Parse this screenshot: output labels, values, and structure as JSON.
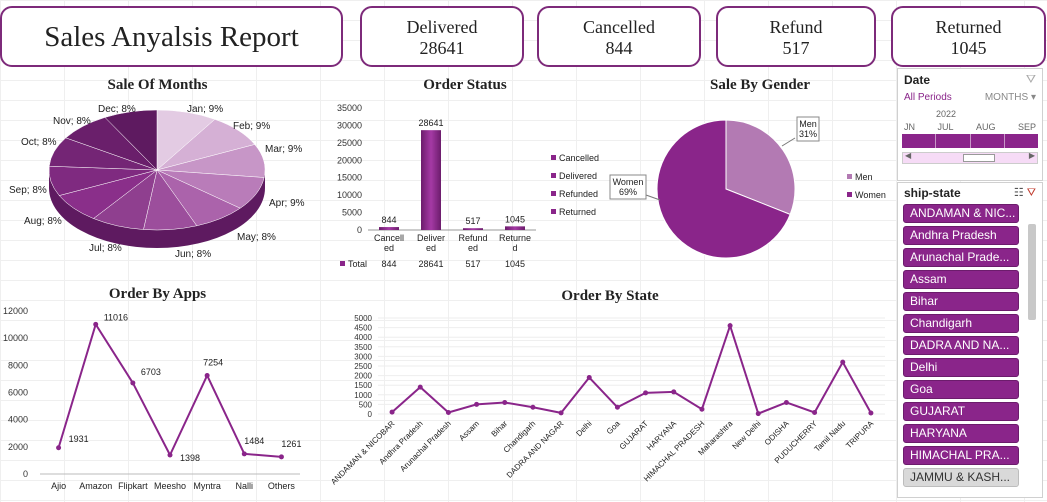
{
  "report": {
    "title": "Sales Anyalsis Report"
  },
  "kpis": [
    {
      "label": "Delivered",
      "value": "28641"
    },
    {
      "label": "Cancelled",
      "value": "844"
    },
    {
      "label": "Refund",
      "value": "517"
    },
    {
      "label": "Returned",
      "value": "1045"
    }
  ],
  "colors": {
    "accent": "#7d2a7a",
    "purple": "#8a258a",
    "light_purple": "#c796c7"
  },
  "chart_data": [
    {
      "type": "pie",
      "title": "Sale Of Months",
      "categories": [
        "Jan",
        "Feb",
        "Mar",
        "Apr",
        "May",
        "Jun",
        "Jul",
        "Aug",
        "Sep",
        "Oct",
        "Nov",
        "Dec"
      ],
      "values": [
        9,
        9,
        9,
        9,
        8,
        8,
        8,
        8,
        8,
        8,
        8,
        8
      ],
      "labels": [
        "Jan; 9%",
        "Feb; 9%",
        "Mar; 9%",
        "Apr; 9%",
        "May; 8%",
        "Jun; 8%",
        "Jul; 8%",
        "Aug; 8%",
        "Sep; 8%",
        "Oct; 8%",
        "Nov; 8%",
        "Dec; 8%"
      ]
    },
    {
      "type": "bar",
      "title": "Order Status",
      "categories": [
        "Cancelled",
        "Delivered",
        "Refunded",
        "Returned"
      ],
      "axis_labels": [
        "Cancell ed",
        "Deliver ed",
        "Refund ed",
        "Returne d"
      ],
      "series": [
        {
          "name": "Total",
          "values": [
            844,
            28641,
            517,
            1045
          ]
        }
      ],
      "ylim": [
        0,
        35000
      ],
      "yticks": [
        "35000",
        "30000",
        "25000",
        "20000",
        "15000",
        "10000",
        "5000",
        "0"
      ],
      "legend": [
        "Cancelled",
        "Delivered",
        "Refunded",
        "Returned"
      ],
      "table_label": "Total",
      "table_values": [
        "844",
        "28641",
        "517",
        "1045"
      ]
    },
    {
      "type": "pie",
      "title": "Sale By Gender",
      "categories": [
        "Men",
        "Women"
      ],
      "values": [
        31,
        69
      ],
      "callouts": [
        [
          "Men",
          "31%"
        ],
        [
          "Women",
          "69%"
        ]
      ],
      "legend": [
        "Men",
        "Women"
      ]
    },
    {
      "type": "line",
      "title": "Order By Apps",
      "categories": [
        "Ajio",
        "Amazon",
        "Flipkart",
        "Meesho",
        "Myntra",
        "Nalli",
        "Others"
      ],
      "values": [
        1931,
        11016,
        6703,
        1398,
        7254,
        1484,
        1261
      ],
      "ylim": [
        0,
        12000
      ],
      "yticks": [
        "12000",
        "10000",
        "8000",
        "6000",
        "4000",
        "2000",
        "0"
      ]
    },
    {
      "type": "line",
      "title": "Order By State",
      "categories": [
        "ANDAMAN & NICOBAR",
        "Andhra Pradesh",
        "Arunachal Pradesh",
        "Assam",
        "Bihar",
        "Chandigarh",
        "DADRA AND NAGAR",
        "Delhi",
        "Goa",
        "GUJARAT",
        "HARYANA",
        "HIMACHAL PRADESH",
        "Maharashtra",
        "New Delhi",
        "ODISHA",
        "PUDUCHERRY",
        "Tamil Nadu",
        "TRIPURA"
      ],
      "values": [
        100,
        1400,
        80,
        500,
        600,
        350,
        60,
        1900,
        350,
        1100,
        1150,
        250,
        4600,
        20,
        600,
        80,
        2700,
        50
      ],
      "ylim": [
        0,
        5000
      ],
      "yticks": [
        "5000",
        "4500",
        "4000",
        "3500",
        "3000",
        "2500",
        "2000",
        "1500",
        "1000",
        "500",
        "0"
      ]
    }
  ],
  "date_slicer": {
    "title": "Date",
    "period": "All Periods",
    "level": "MONTHS",
    "year": "2022",
    "months": [
      "JN",
      "JUL",
      "AUG",
      "SEP"
    ]
  },
  "state_slicer": {
    "title": "ship-state",
    "items": [
      "ANDAMAN & NIC...",
      "Andhra Pradesh",
      "Arunachal Prade...",
      "Assam",
      "Bihar",
      "Chandigarh",
      "DADRA AND NA...",
      "Delhi",
      "Goa",
      "GUJARAT",
      "HARYANA",
      "HIMACHAL PRA...",
      "JAMMU & KASH..."
    ]
  }
}
